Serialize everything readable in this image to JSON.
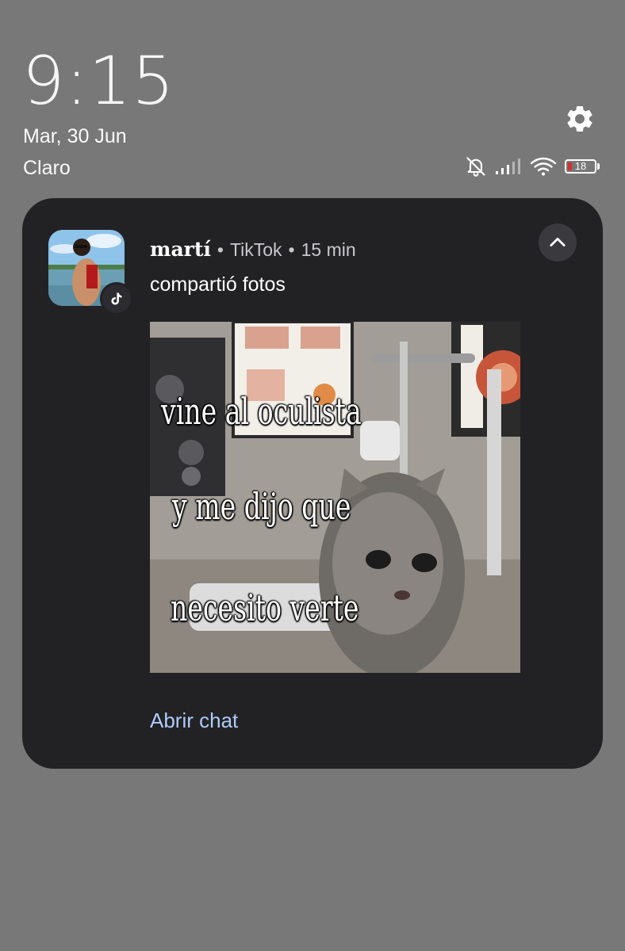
{
  "status": {
    "time": "9:15",
    "date": "Mar, 30 Jun",
    "carrier": "Claro",
    "battery_level": "18",
    "icons": [
      "settings-icon",
      "bell-off-icon",
      "signal-icon",
      "wifi-icon",
      "battery-icon"
    ]
  },
  "notification": {
    "sender": "martí",
    "app": "TikTok",
    "time_ago": "15 min",
    "separator": "•",
    "message": "compartió fotos",
    "action": "Abrir chat",
    "image": {
      "caption_lines": [
        "vine al oculista",
        "y me dijo que",
        "necesito verte"
      ]
    }
  },
  "colors": {
    "background": "#787878",
    "card": "#222224",
    "action": "#aecbfa",
    "battery_low": "#d32f2f"
  }
}
